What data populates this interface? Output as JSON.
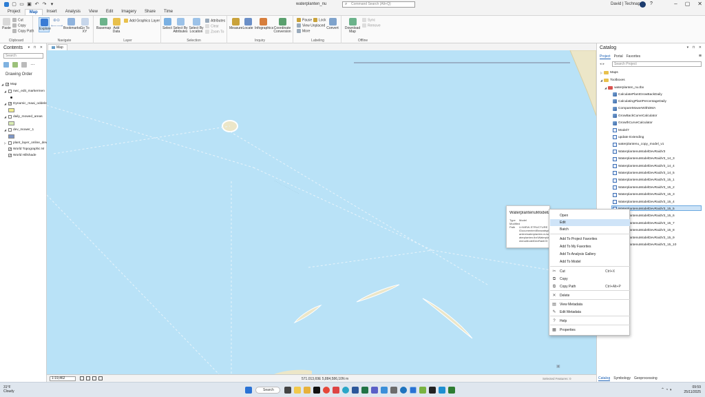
{
  "window": {
    "title": "waterplanten_nu",
    "command_search_placeholder": "Command Search (Alt+Q)",
    "user": "David | Technaps",
    "help": "?"
  },
  "ribbon_tabs": [
    "Project",
    "Map",
    "Insert",
    "Analysis",
    "View",
    "Edit",
    "Imagery",
    "Share",
    "Time"
  ],
  "ribbon": {
    "clipboard": {
      "label": "Clipboard",
      "paste": "Paste",
      "cut": "Cut",
      "copy": "Copy",
      "copy_path": "Copy Path"
    },
    "navigate": {
      "label": "Navigate",
      "explore": "Explore",
      "bookmarks": "Bookmarks",
      "go_to_xy": "Go To XY"
    },
    "layer": {
      "label": "Layer",
      "basemap": "Basemap",
      "add_data": "Add Data",
      "add_graphics_layer": "Add Graphics Layer"
    },
    "selection": {
      "label": "Selection",
      "select": "Select",
      "select_by_attributes": "Select By Attributes",
      "select_by_location": "Select By Location",
      "attributes": "Attributes",
      "clear": "Clear",
      "zoom_to": "Zoom To"
    },
    "inquiry": {
      "label": "Inquiry",
      "measure": "Measure",
      "locate": "Locate",
      "infographics": "Infographics",
      "coordinate_conversion": "Coordinate Conversion"
    },
    "labeling": {
      "label": "Labeling",
      "pause": "Pause",
      "lock": "Lock",
      "view_unplaced": "View Unplaced",
      "more": "More",
      "convert": "Convert"
    },
    "offline": {
      "label": "Offline",
      "download_map": "Download Map",
      "sync": "Sync",
      "remove": "Remove"
    }
  },
  "contents": {
    "title": "Contents",
    "search_placeholder": "Search",
    "drawing_order": "Drawing Order",
    "layers": [
      {
        "name": "Map",
        "checked": true,
        "level": 0
      },
      {
        "name": "nwc_edit_markermen",
        "checked": false,
        "level": 1
      },
      {
        "name": "Dynamic_maai_oddelen",
        "checked": true,
        "level": 1
      },
      {
        "name": "daily_mowed_areas",
        "checked": false,
        "level": 1
      },
      {
        "name": "dev_mower_1",
        "checked": false,
        "level": 1
      },
      {
        "name": "plant_layer_online_dev",
        "checked": false,
        "level": 1
      },
      {
        "name": "World Topographic M",
        "checked": true,
        "level": 1
      },
      {
        "name": "World Hillshade",
        "checked": true,
        "level": 1
      }
    ]
  },
  "map": {
    "tab_label": "Map",
    "scale": "1:19,462",
    "coordinates": "571.013,69E 5,884,586,10N m",
    "selected_features": "Selected Features: 0",
    "water_color": "#b9e2f7",
    "land_color": "#ece6c8"
  },
  "catalog": {
    "title": "Catalog",
    "tabs": [
      "Project",
      "Portal",
      "Favorites"
    ],
    "search_placeholder": "Search Project",
    "tree": [
      {
        "label": "Maps",
        "icon": "folder-icon"
      },
      {
        "label": "Toolboxes",
        "icon": "folder-icon"
      },
      {
        "label": "waterplanten_nu.tbx",
        "icon": "toolbox-icon"
      },
      {
        "label": "CalculatePlantGrowBackDaily",
        "icon": "tool-icon"
      },
      {
        "label": "CalculatingPlantPercentageDaily",
        "icon": "tool-icon"
      },
      {
        "label": "CompareMowerWithDMA",
        "icon": "tool-icon"
      },
      {
        "label": "GrowBackCurveCalculator",
        "icon": "tool-icon"
      },
      {
        "label": "GrowthCurveCalculator",
        "icon": "tool-icon"
      },
      {
        "label": "Model7",
        "icon": "model-icon"
      },
      {
        "label": "update Extending",
        "icon": "model-icon"
      },
      {
        "label": "waterplantenu_copy_model_v1",
        "icon": "model-icon"
      },
      {
        "label": "WaterplantenuModelDevRaidV3",
        "icon": "model-icon"
      },
      {
        "label": "WaterplantenuModelDevRaidV3_14_3",
        "icon": "model-icon"
      },
      {
        "label": "WaterplantenuModelDevRaidV3_14_4",
        "icon": "model-icon"
      },
      {
        "label": "WaterplantenuModelDevRaidV3_14_5",
        "icon": "model-icon"
      },
      {
        "label": "WaterplantenuModelDevRaidV3_15_1",
        "icon": "model-icon"
      },
      {
        "label": "WaterplantenuModelDevRaidV3_15_2",
        "icon": "model-icon"
      },
      {
        "label": "WaterplantenuModelDevRaidV3_15_3",
        "icon": "model-icon"
      },
      {
        "label": "WaterplantenuModelDevRaidV3_15_4",
        "icon": "model-icon"
      },
      {
        "label": "WaterplantenuModelDevRaidV3_15_5",
        "icon": "model-icon"
      },
      {
        "label": "WaterplantenuModelDevRaidV3_15_6",
        "icon": "model-icon"
      },
      {
        "label": "WaterplantenuModelDevRaidV3_15_7",
        "icon": "model-icon"
      },
      {
        "label": "WaterplantenuModelDevRaidV3_15_8",
        "icon": "model-icon"
      },
      {
        "label": "WaterplantenuModelDevRaidV3_15_9",
        "icon": "model-icon"
      },
      {
        "label": "WaterplantenuModelDevRaidV3_15_10",
        "icon": "model-icon"
      }
    ],
    "bottom_tabs": [
      "Catalog",
      "Symbology",
      "Geoprocessing"
    ]
  },
  "tooltip": {
    "title": "WaterplantenuModelDevRaidV3_15_6",
    "type_label": "Type",
    "type_value": "Model",
    "modified_label": "Modified",
    "modified_value": "",
    "path_label": "Path",
    "path_value": "U:\\WEW-STRUCTURE\\Documenten\\Bezwatsplanten\\waterplanten.nu\\waterplanten.tbx\\WaterplantenuModelDevRaidV3_15_6"
  },
  "context_menu": {
    "items": [
      {
        "label": "Open",
        "shortcut": "",
        "icon": ""
      },
      {
        "label": "Edit",
        "shortcut": "",
        "icon": "",
        "highlighted": true
      },
      {
        "label": "Batch",
        "shortcut": "",
        "icon": ""
      },
      {
        "label": "Add To Project Favorites",
        "shortcut": "",
        "icon": ""
      },
      {
        "label": "Add To My Favorites",
        "shortcut": "",
        "icon": ""
      },
      {
        "label": "Add To Analysis Gallery",
        "shortcut": "",
        "icon": ""
      },
      {
        "label": "Add To Model",
        "shortcut": "",
        "icon": ""
      },
      {
        "label": "Cut",
        "shortcut": "Ctrl+X",
        "icon": "✂"
      },
      {
        "label": "Copy",
        "shortcut": "",
        "icon": "⧉"
      },
      {
        "label": "Copy Path",
        "shortcut": "Ctrl+Alt+P",
        "icon": "⧉"
      },
      {
        "label": "Delete",
        "shortcut": "",
        "icon": "✕"
      },
      {
        "label": "View Metadata",
        "shortcut": "",
        "icon": "▤"
      },
      {
        "label": "Edit Metadata",
        "shortcut": "",
        "icon": "✎"
      },
      {
        "label": "Help",
        "shortcut": "",
        "icon": "?"
      },
      {
        "label": "Properties",
        "shortcut": "",
        "icon": "▦"
      }
    ]
  },
  "taskbar": {
    "temperature": "31°F",
    "weather": "Cloudy",
    "search": "Search",
    "time": "09:59",
    "date": "25/11/2025"
  }
}
